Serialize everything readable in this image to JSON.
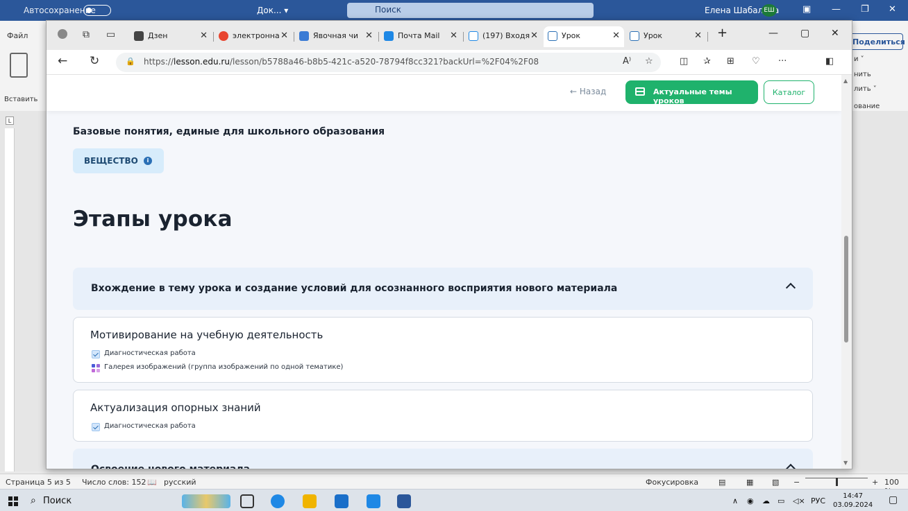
{
  "word": {
    "autosave": "Автосохранение",
    "doc": "Док... ▾",
    "search": "Поиск",
    "user": "Елена Шабалина",
    "user_initials": "ЕШ",
    "file_tab": "Файл",
    "paste": "Вставить",
    "share": "Поделиться",
    "ribbon_right": [
      "и ˅",
      "нить",
      "лить ˅",
      "ование"
    ],
    "status": {
      "page": "Страница 5 из 5",
      "words": "Число слов: 152",
      "lang": "русский",
      "focus": "Фокусировка",
      "zoom": "100 %"
    }
  },
  "browser": {
    "tabs": [
      {
        "label": "Дзен",
        "color": "#444"
      },
      {
        "label": "электронна",
        "color": "#e8452f"
      },
      {
        "label": "Явочная чи",
        "color": "#3a7bd5"
      },
      {
        "label": "Почта Mail",
        "color": "#1e88e5"
      },
      {
        "label": "(197) Входя",
        "color": "#1e88e5"
      },
      {
        "label": "Урок",
        "color": "#2a6fb5"
      },
      {
        "label": "Урок",
        "color": "#2a6fb5"
      }
    ],
    "url_prefix": "https://",
    "url_domain": "lesson.edu.ru",
    "url_path": "/lesson/b5788a46-b8b5-421c-a520-78794f8cc321?backUrl=%2F04%2F08"
  },
  "page": {
    "back": "← Назад",
    "actual_topics": "Актуальные темы уроков",
    "catalog": "Каталог",
    "basic_title": "Базовые понятия, единые для школьного образования",
    "chip": "ВЕЩЕСТВО",
    "stages_title": "Этапы урока",
    "stage1": "Вхождение в тему урока и создание условий для осознанного восприятия нового материала",
    "card1": {
      "title": "Мотивирование на учебную деятельность",
      "items": [
        "Диагностическая работа",
        "Галерея изображений (группа изображений по одной тематике)"
      ]
    },
    "card2": {
      "title": "Актуализация опорных знаний",
      "items": [
        "Диагностическая работа"
      ]
    },
    "stage2": "Освоение нового материала"
  },
  "taskbar": {
    "search": "Поиск",
    "lang": "РУС",
    "time": "14:47",
    "date": "03.09.2024"
  },
  "colors": {
    "accent_green": "#1fb26c",
    "word_blue": "#2b579a",
    "stage_bg": "#e8f0fa",
    "chip_bg": "#d7ecfb"
  }
}
